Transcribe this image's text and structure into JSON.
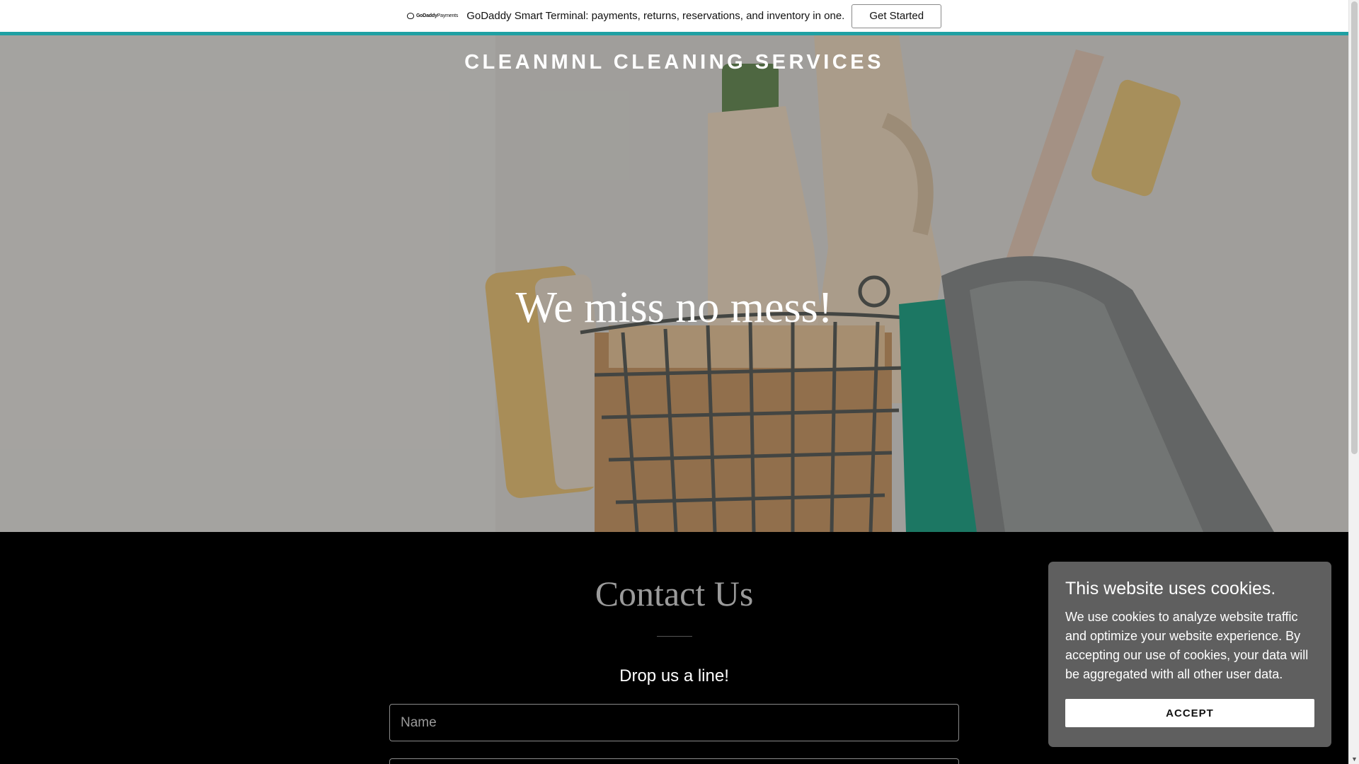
{
  "promo": {
    "logo_brand": "GoDaddy",
    "logo_product": "Payments",
    "text": "GoDaddy Smart Terminal: payments, returns, reservations, and inventory in one.",
    "button_label": "Get Started"
  },
  "header": {
    "site_title": "CLEANMNL CLEANING SERVICES"
  },
  "hero": {
    "tagline": "We miss no mess!"
  },
  "contact": {
    "title": "Contact Us",
    "subtitle": "Drop us a line!",
    "name_placeholder": "Name",
    "email_placeholder": ""
  },
  "cookie": {
    "title": "This website uses cookies.",
    "text": "We use cookies to analyze website traffic and optimize your website experience. By accepting our use of cookies, your data will be aggregated with all other user data.",
    "accept_label": "ACCEPT"
  },
  "colors": {
    "accent": "#1ea0a3",
    "background": "#000000",
    "cookie_bg": "#5f5f5f"
  }
}
